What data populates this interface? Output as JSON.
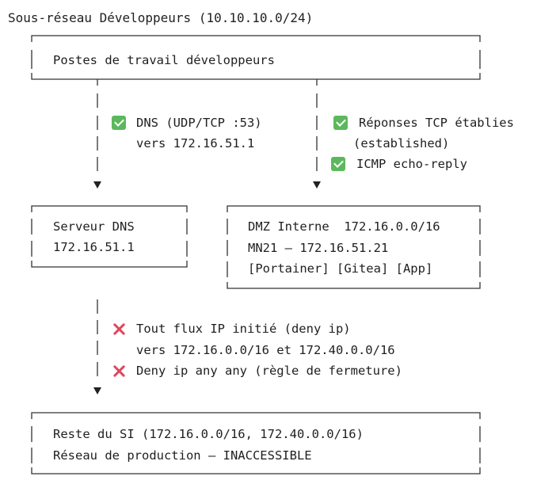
{
  "title": "Sous-réseau Développeurs (10.10.10.0/24)",
  "dev_box": {
    "label": "Postes de travail développeurs"
  },
  "dns_flow": {
    "line1": "DNS (UDP/TCP :53)",
    "line2": "vers 172.16.51.1",
    "icon": "check-icon"
  },
  "dmz_flow": {
    "line1": "Réponses TCP établies",
    "line2": "(established)",
    "line3": "ICMP echo-reply",
    "icon": "check-icon"
  },
  "dns_box": {
    "line1": "Serveur DNS",
    "line2": "172.16.51.1"
  },
  "dmz_box": {
    "line1": "DMZ Interne  172.16.0.0/16",
    "line2": "MN21 — 172.16.51.21",
    "line3": "[Portainer] [Gitea] [App]"
  },
  "deny_flow": {
    "line1": "Tout flux IP initié (deny ip)",
    "line2": "vers 172.16.0.0/16 et 172.40.0.0/16",
    "line3": "Deny ip any any (règle de fermeture)",
    "icon": "cross-icon"
  },
  "rest_box": {
    "line1": "Reste du SI (172.16.0.0/16, 172.40.0.0/16)",
    "line2": "Réseau de production — INACCESSIBLE"
  },
  "colors": {
    "check": "#5cb85c",
    "cross": "#e0475e",
    "line": "#333333"
  }
}
